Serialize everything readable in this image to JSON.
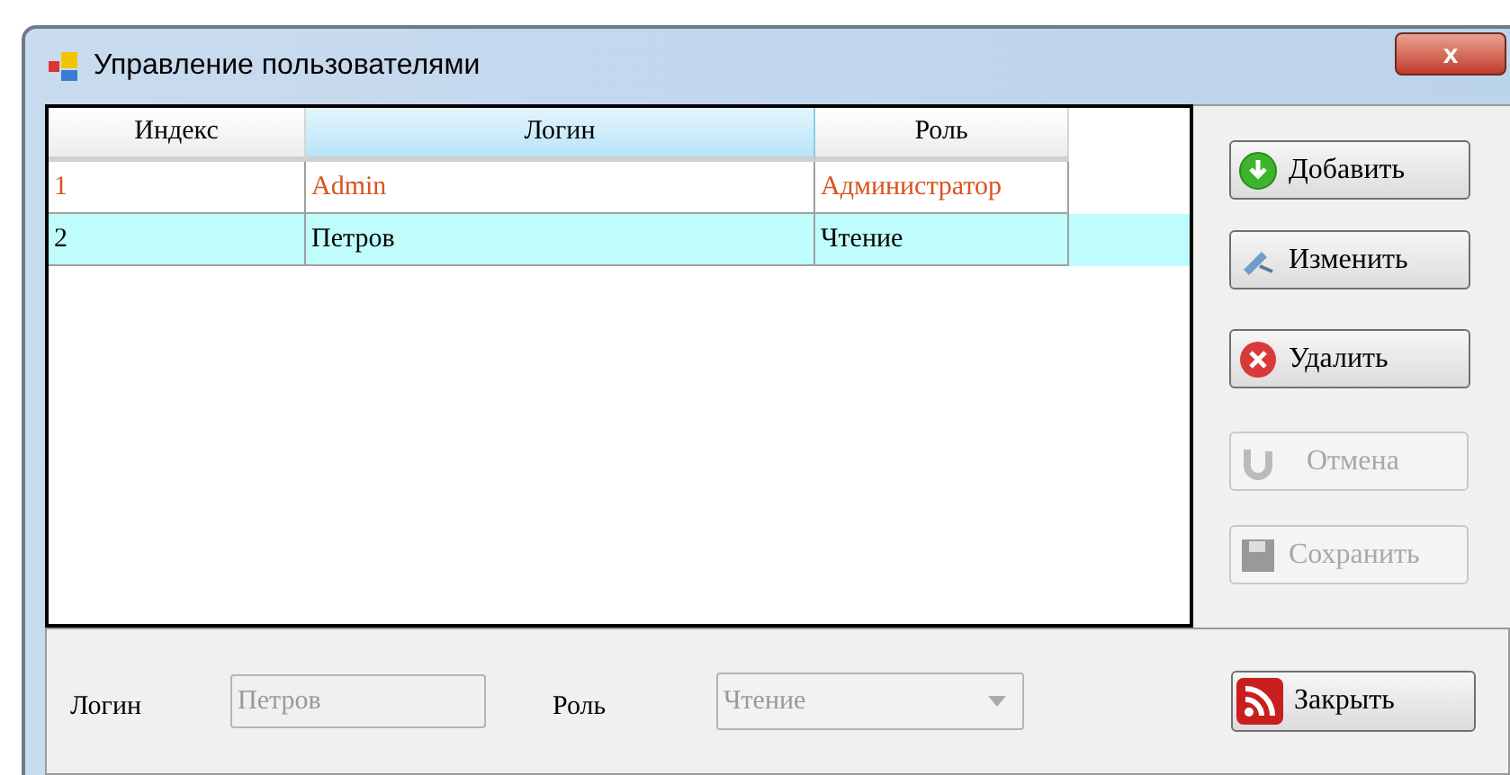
{
  "window": {
    "title": "Управление пользователями",
    "close": "x"
  },
  "table": {
    "columns": [
      {
        "label": "Индекс",
        "selected": false
      },
      {
        "label": "Логин",
        "selected": true
      },
      {
        "label": "Роль",
        "selected": false
      }
    ],
    "rows": [
      {
        "cells": [
          "1",
          "Admin",
          "Администратор"
        ],
        "selected": false,
        "color": "#d9531e"
      },
      {
        "cells": [
          "2",
          "Петров",
          "Чтение"
        ],
        "selected": true,
        "color": "#000000"
      }
    ]
  },
  "buttons": [
    {
      "label": "Добавить",
      "kind": "add",
      "disabled": false
    },
    {
      "label": "Изменить",
      "kind": "edit",
      "disabled": false
    },
    {
      "label": "Удалить",
      "kind": "delete",
      "disabled": false
    },
    {
      "label": "Отмена",
      "kind": "undo",
      "disabled": true
    },
    {
      "label": "Сохранить",
      "kind": "save",
      "disabled": true
    }
  ],
  "form": {
    "login_label": "Логин",
    "login_value": "Петров",
    "login_disabled": true,
    "role_label": "Роль",
    "role_value": "Чтение",
    "role_disabled": true
  },
  "close_button": {
    "label": "Закрыть"
  }
}
